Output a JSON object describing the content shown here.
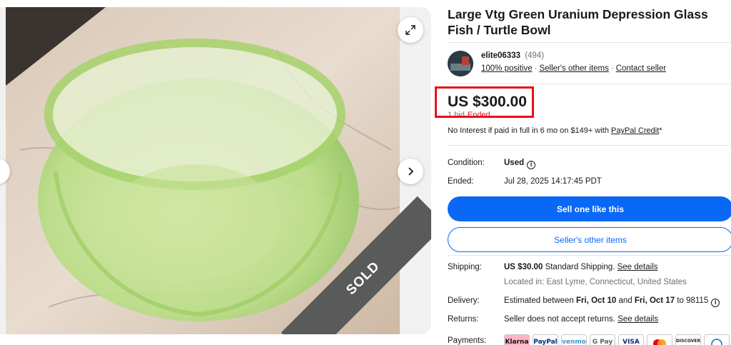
{
  "gallery": {
    "sold_label": "SOLD",
    "icons": {
      "expand": "expand-icon",
      "next": "chevron-right-icon",
      "prev": "chevron-left-icon"
    }
  },
  "listing": {
    "title": "Large Vtg Green Uranium Depression Glass Fish / Turtle Bowl"
  },
  "seller": {
    "name": "elite06333",
    "feedback_count": "(494)",
    "positive": "100% positive",
    "other_items": "Seller's other items",
    "contact": "Contact seller"
  },
  "price": {
    "amount": "US $300.00",
    "bids": "1 bid",
    "status": "Ended",
    "highlight_color": "#e8101a"
  },
  "financing": {
    "text": "No Interest if paid in full in 6 mo on $149+ with",
    "link": "PayPal Credit",
    "suffix": "*"
  },
  "details": {
    "condition_label": "Condition:",
    "condition_value": "Used",
    "ended_label": "Ended:",
    "ended_value": "Jul 28, 2025 14:17:45 PDT"
  },
  "actions": {
    "primary": "Sell one like this",
    "secondary": "Seller's other items",
    "accent_color": "#0968f6"
  },
  "shipping": {
    "label": "Shipping:",
    "cost": "US $30.00",
    "method": "Standard Shipping.",
    "details_link": "See details",
    "location": "Located in: East Lyme, Connecticut, United States"
  },
  "delivery": {
    "label": "Delivery:",
    "prefix": "Estimated between",
    "start": "Fri, Oct 10",
    "and": "and",
    "end": "Fri, Oct 17",
    "to": "to 98115"
  },
  "returns": {
    "label": "Returns:",
    "text": "Seller does not accept returns.",
    "details_link": "See details"
  },
  "payments": {
    "label": "Payments:",
    "methods": [
      "Klarna",
      "PayPal",
      "venmo",
      "G Pay",
      "VISA",
      "Mastercard",
      "DISCOVER",
      "Diners"
    ]
  }
}
